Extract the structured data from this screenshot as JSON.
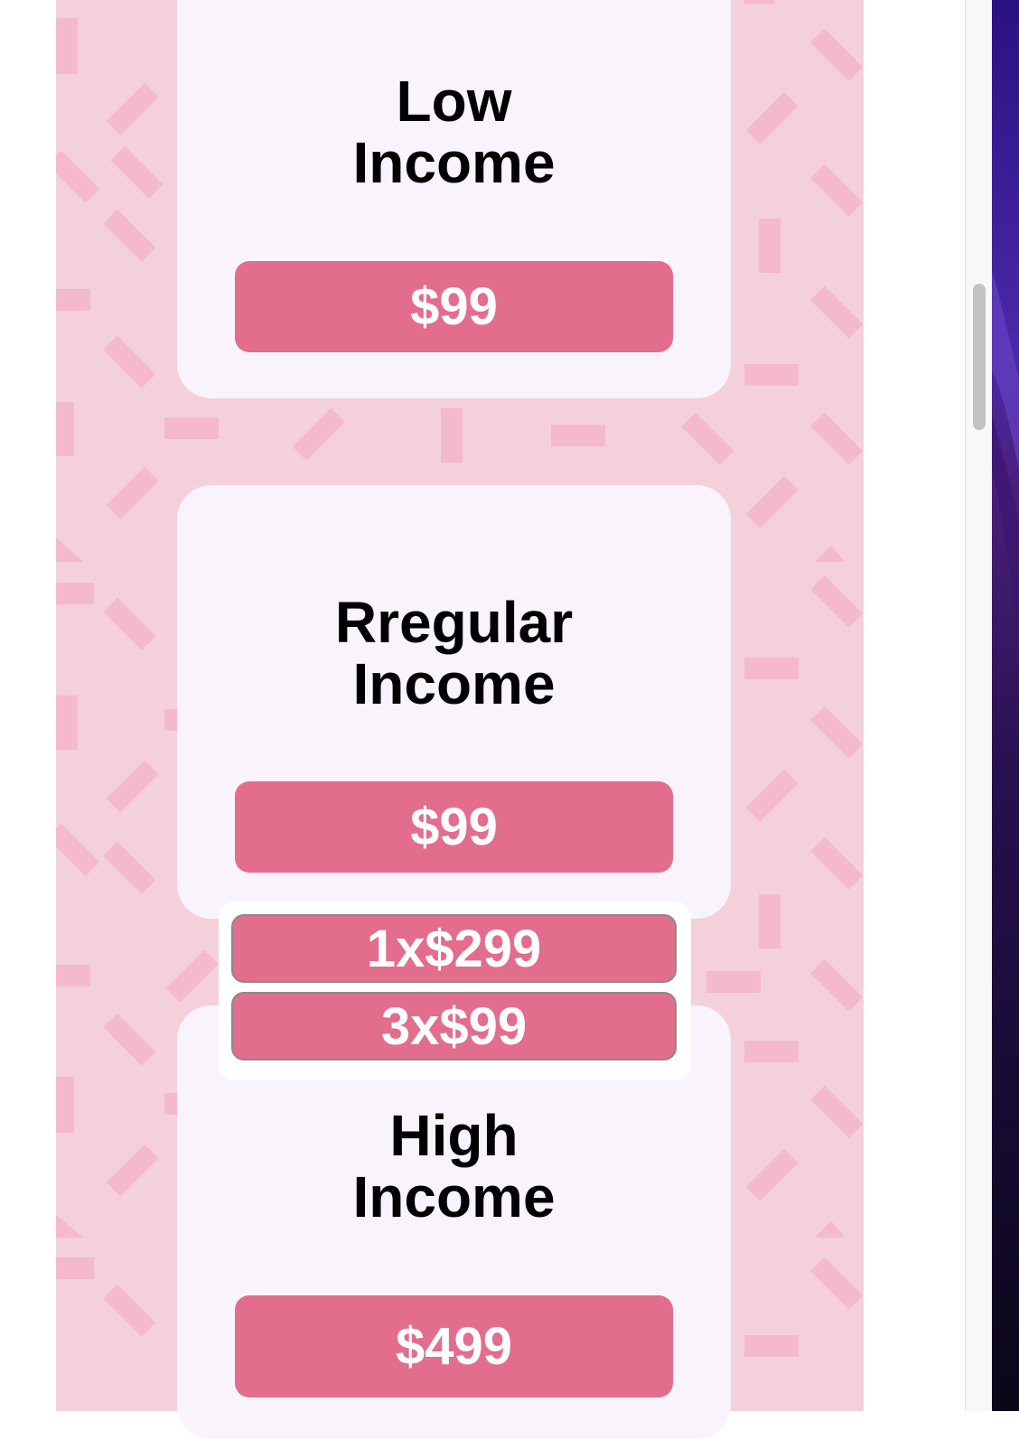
{
  "plans": [
    {
      "title_line1": "Low",
      "title_line2": "Income",
      "price": "$99"
    },
    {
      "title_line1": "Rregular",
      "title_line2": "Income",
      "price": "$99"
    },
    {
      "title_line1": "High",
      "title_line2": "Income",
      "price": "$499"
    }
  ],
  "payment_popup": {
    "options": [
      "1x$299",
      "3x$99"
    ]
  },
  "colors": {
    "background_pattern": "#f3d0da",
    "pattern_shape": "#f4b9cc",
    "card": "#f9f3fb",
    "button": "#e26d8c",
    "button_text": "#ffffff"
  }
}
